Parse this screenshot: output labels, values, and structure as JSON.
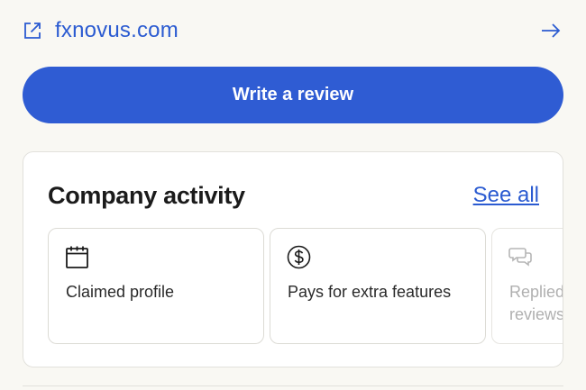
{
  "website": {
    "label": "fxnovus.com",
    "icon": "external-link-icon",
    "arrow_icon": "arrow-right-icon",
    "color": "#2b5bd1"
  },
  "write_review": {
    "label": "Write a review",
    "color": "#2f5cd3"
  },
  "company_activity": {
    "title": "Company activity",
    "see_all": "See all",
    "items": [
      {
        "label": "Claimed profile",
        "icon": "calendar-icon"
      },
      {
        "label": "Pays for extra features",
        "icon": "dollar-circle-icon"
      },
      {
        "label": "Replied to negative reviews",
        "icon": "speech-bubbles-icon"
      }
    ]
  }
}
